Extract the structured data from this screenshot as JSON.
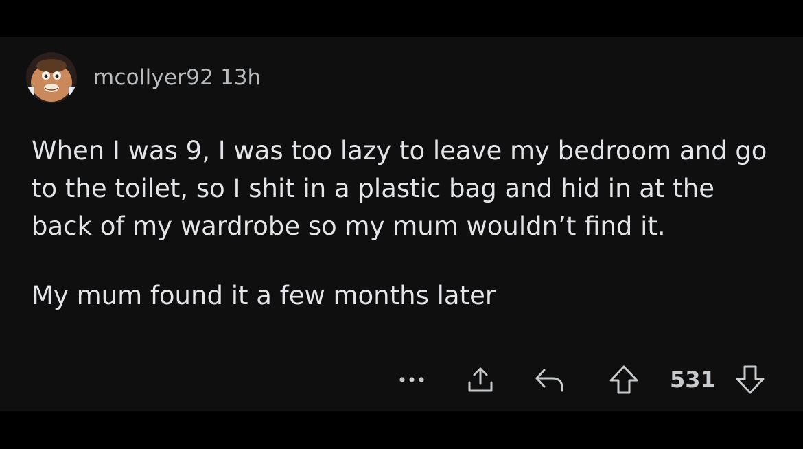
{
  "comment": {
    "username": "mcollyer92",
    "timestamp": "13h",
    "paragraphs": [
      "When I was 9, I was too lazy to leave my bedroom and go to the toilet, so I shit in a plastic bag and hid in at the back of my wardrobe so my mum wouldn’t find it.",
      "My mum found it a few months later"
    ]
  },
  "actions": {
    "more_icon": "more-dots-icon",
    "share_icon": "share-icon",
    "reply_icon": "reply-icon",
    "upvote_icon": "upvote-arrow-icon",
    "score": "531",
    "downvote_icon": "downvote-arrow-icon"
  },
  "colors": {
    "background": "#000000",
    "card": "#0f0f0f",
    "text": "#e3e5e8",
    "meta": "#b8bbbe"
  }
}
